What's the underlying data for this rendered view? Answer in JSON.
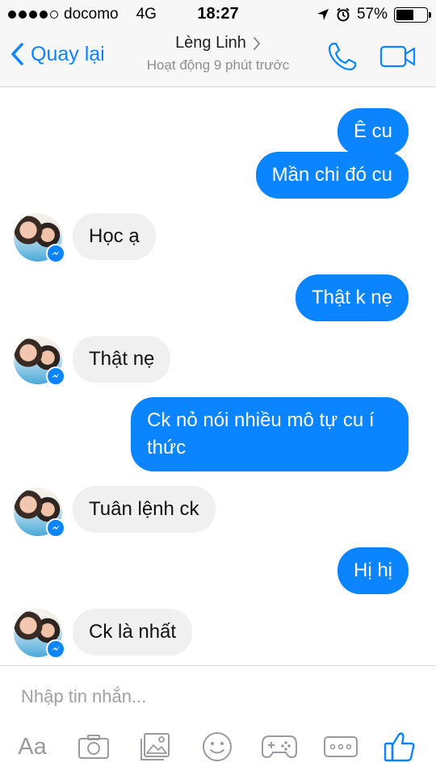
{
  "status_bar": {
    "carrier": "docomo",
    "network": "4G",
    "time": "18:27",
    "battery": "57%",
    "battery_level": 0.57
  },
  "header": {
    "back_label": "Quay lại",
    "contact_name": "Lèng Linh",
    "contact_status": "Hoạt động 9 phút trước",
    "accent_color": "#0a84ff"
  },
  "messages": [
    {
      "from": "me",
      "text": "Ê cu"
    },
    {
      "from": "me",
      "text": "Mần chi đó cu"
    },
    {
      "from": "them",
      "text": "Học ạ"
    },
    {
      "from": "me",
      "text": "Thật k nẹ"
    },
    {
      "from": "them",
      "text": "Thật nẹ"
    },
    {
      "from": "me",
      "text": "Ck nỏ nói nhiều mô tự cu í thức"
    },
    {
      "from": "them",
      "text": "Tuân lệnh ck"
    },
    {
      "from": "me",
      "text": "Hị hị"
    },
    {
      "from": "them",
      "text": "Ck là nhất"
    }
  ],
  "composer": {
    "placeholder": "Nhập tin nhắn...",
    "aa_label": "Aa",
    "tools": [
      "text-format-icon",
      "camera-icon",
      "gallery-icon",
      "emoji-icon",
      "game-controller-icon",
      "more-icon",
      "like-icon"
    ]
  }
}
